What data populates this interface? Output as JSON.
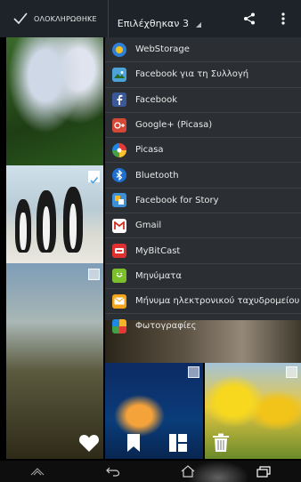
{
  "topbar": {
    "done_label": "ΟΛΟΚΛΗΡΩΘΗΚΕ",
    "selected_label": "Επιλέχθηκαν 3",
    "share_icon": "share-icon",
    "overflow_icon": "overflow-menu-icon"
  },
  "share_menu": {
    "items": [
      {
        "label": "WebStorage",
        "icon": "webstorage-icon",
        "color": "#2f7fd6"
      },
      {
        "label": "Facebook για τη Συλλογή",
        "icon": "facebook-gallery-icon",
        "color": "#4ba3d8"
      },
      {
        "label": "Facebook",
        "icon": "facebook-icon",
        "color": "#3b5998"
      },
      {
        "label": "Google+ (Picasa)",
        "icon": "google-plus-icon",
        "color": "#d34836"
      },
      {
        "label": "Picasa",
        "icon": "picasa-icon",
        "color": "#7a5fb4"
      },
      {
        "label": "Bluetooth",
        "icon": "bluetooth-icon",
        "color": "#1f6fd1"
      },
      {
        "label": "Facebook for Story",
        "icon": "facebook-story-icon",
        "color": "#3d8fd8"
      },
      {
        "label": "Gmail",
        "icon": "gmail-icon",
        "color": "#ffffff"
      },
      {
        "label": "MyBitCast",
        "icon": "mybitcast-icon",
        "color": "#e03030"
      },
      {
        "label": "Μηνύματα",
        "icon": "messages-icon",
        "color": "#7bbf2a"
      },
      {
        "label": "Μήνυμα ηλεκτρονικού ταχυδρομείου",
        "icon": "email-icon",
        "color": "#f2a51a"
      },
      {
        "label": "Φωτογραφίες",
        "icon": "photos-icon",
        "color": "#e8c23a"
      }
    ]
  },
  "actions": {
    "favorite_icon": "heart-icon",
    "bookmark_icon": "bookmark-icon",
    "layout_icon": "layout-icon",
    "delete_icon": "trash-icon"
  },
  "navbar": {
    "back_icon": "back-icon",
    "home_icon": "home-icon",
    "recents_icon": "recent-apps-icon",
    "up_icon": "chevron-up-icon"
  }
}
